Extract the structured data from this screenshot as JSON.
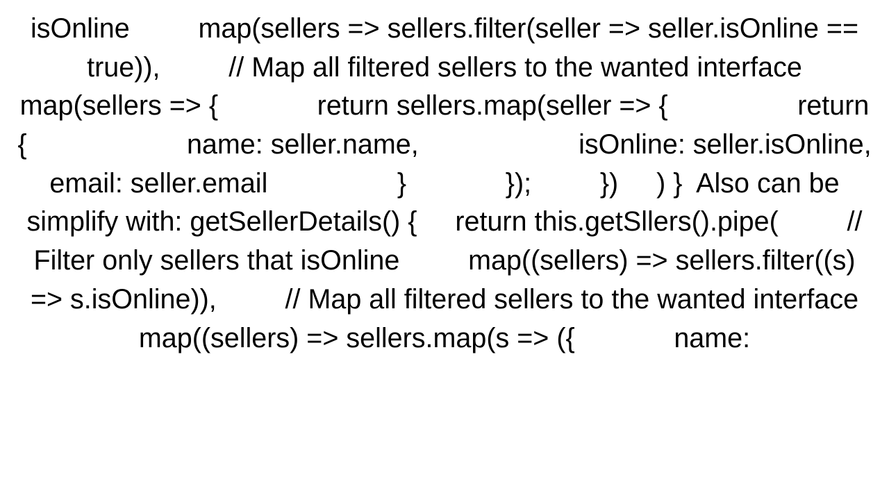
{
  "text": "isOnline         map(sellers => sellers.filter(seller => seller.isOnline == true)),         // Map all filtered sellers to the wanted interface         map(sellers => {             return sellers.map(seller => {                 return {                     name: seller.name,                     isOnline: seller.isOnline,                     email: seller.email                 }             });         })     ) }  Also can be simplify with: getSellerDetails() {     return this.getSllers().pipe(         // Filter only sellers that isOnline         map((sellers) => sellers.filter((s) => s.isOnline)),         // Map all filtered sellers to the wanted interface         map((sellers) => sellers.map(s => ({             name:"
}
